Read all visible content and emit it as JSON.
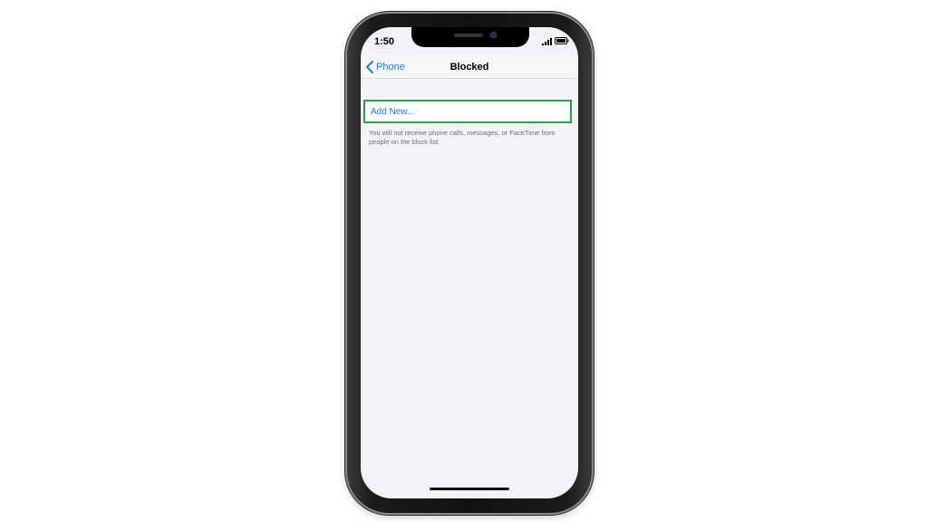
{
  "status_bar": {
    "time": "1:50",
    "signal_icon": "cellular-signal-icon",
    "battery_icon": "battery-icon"
  },
  "nav": {
    "back_label": "Phone",
    "back_icon": "chevron-left-icon",
    "title": "Blocked"
  },
  "blocked_list": {
    "add_new_label": "Add New...",
    "footer_note": "You will not receive phone calls, messages, or FaceTime from people on the block list."
  },
  "colors": {
    "accent": "#1a7cf0",
    "highlight_border": "#2e9e48",
    "background": "#f2f2f7"
  }
}
